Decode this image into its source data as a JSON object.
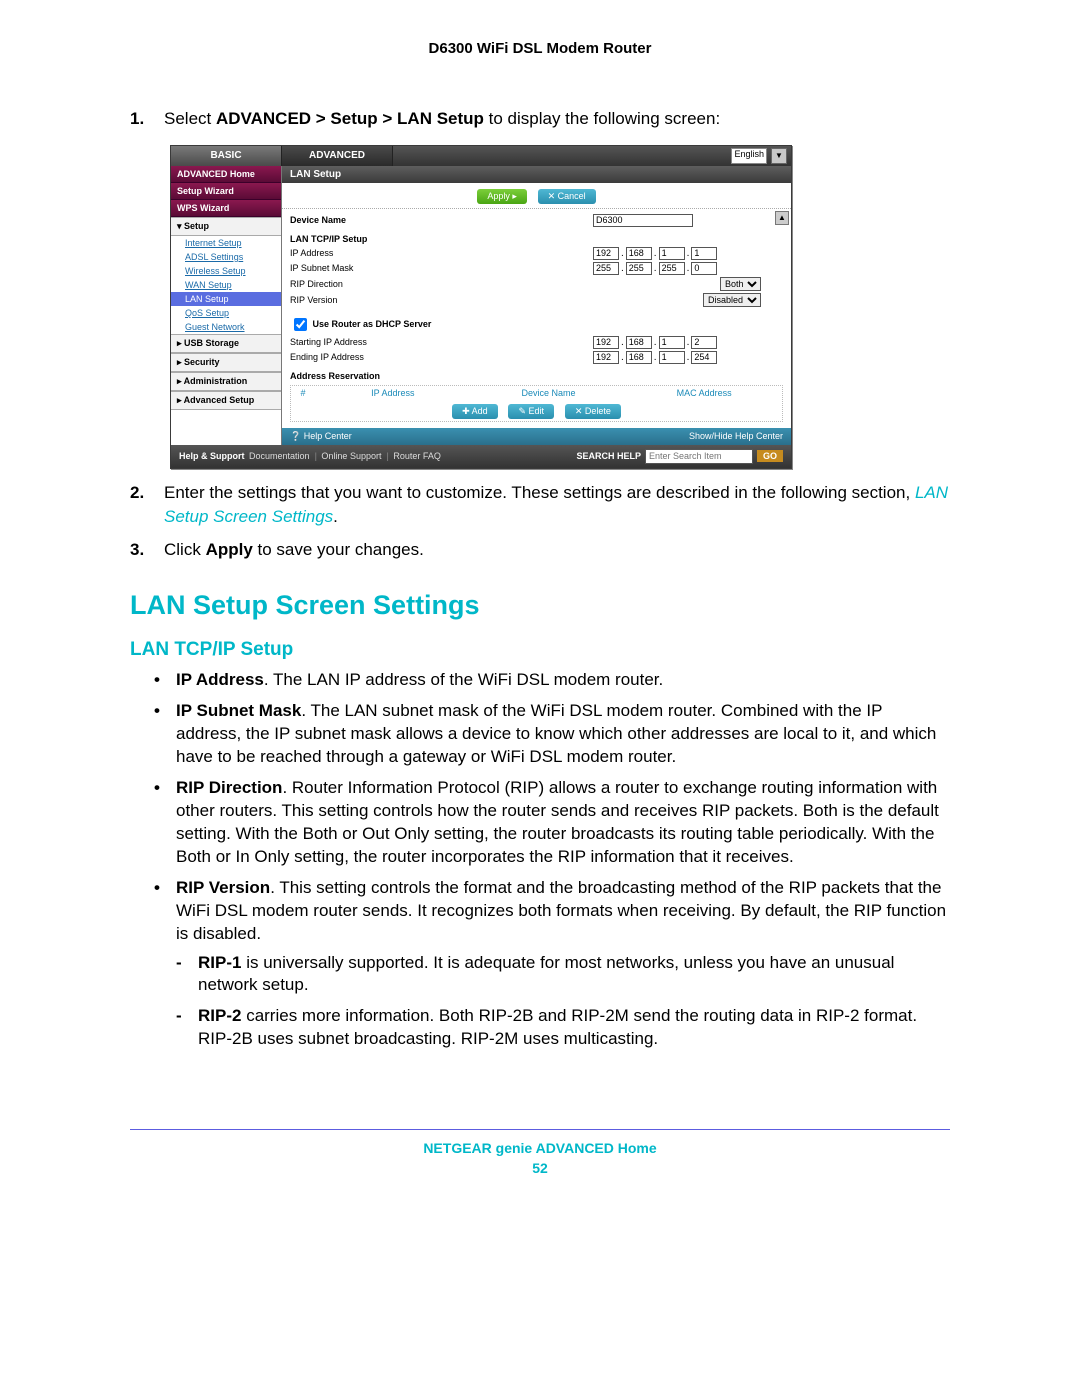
{
  "doc_header": "D6300 WiFi DSL Modem Router",
  "steps": [
    {
      "num": "1.",
      "prefix": "Select ",
      "bold": "ADVANCED > Setup > LAN Setup",
      "suffix": " to display the following screen:"
    },
    {
      "num": "2.",
      "text_a": "Enter the settings that you want to customize. These settings are described in the following section, ",
      "ref": "LAN Setup Screen Settings",
      "text_b": "."
    },
    {
      "num": "3.",
      "prefix": "Click ",
      "bold": "Apply",
      "suffix": " to save your changes."
    }
  ],
  "screenshot": {
    "tabs": {
      "basic": "BASIC",
      "advanced": "ADVANCED",
      "lang": "English"
    },
    "sidebar": {
      "top": [
        "ADVANCED Home",
        "Setup Wizard",
        "WPS Wizard"
      ],
      "setup_header": "▾ Setup",
      "setup_children": [
        "Internet Setup",
        "ADSL Settings",
        "Wireless Setup",
        "WAN Setup",
        "LAN Setup",
        "QoS Setup",
        "Guest Network"
      ],
      "active_child": "LAN Setup",
      "sections": [
        "▸ USB Storage",
        "▸ Security",
        "▸ Administration",
        "▸ Advanced Setup"
      ]
    },
    "panel_title": "LAN Setup",
    "buttons": {
      "apply": "Apply ▸",
      "cancel": "✕ Cancel",
      "add": "✚ Add",
      "edit": "✎ Edit",
      "del": "✕ Delete"
    },
    "device_name": {
      "label": "Device Name",
      "value": "D6300"
    },
    "tcpip_header": "LAN TCP/IP Setup",
    "ip": {
      "label": "IP Address",
      "a": "192",
      "b": "168",
      "c": "1",
      "d": "1"
    },
    "mask": {
      "label": "IP Subnet Mask",
      "a": "255",
      "b": "255",
      "c": "255",
      "d": "0"
    },
    "rip_dir": {
      "label": "RIP Direction",
      "value": "Both"
    },
    "rip_ver": {
      "label": "RIP Version",
      "value": "Disabled"
    },
    "dhcp": {
      "label": "Use Router as DHCP Server",
      "checked": true
    },
    "start": {
      "label": "Starting IP Address",
      "a": "192",
      "b": "168",
      "c": "1",
      "d": "2"
    },
    "end": {
      "label": "Ending IP Address",
      "a": "192",
      "b": "168",
      "c": "1",
      "d": "254"
    },
    "reservation": {
      "header": "Address Reservation",
      "cols": [
        "#",
        "IP Address",
        "Device Name",
        "MAC Address"
      ]
    },
    "help_center": {
      "left": "❔ Help Center",
      "right": "Show/Hide Help Center"
    },
    "footer": {
      "support_label": "Help & Support",
      "doc": "Documentation",
      "online": "Online Support",
      "faq": "Router FAQ",
      "search_label": "SEARCH HELP",
      "search_placeholder": "Enter Search Item",
      "go": "GO"
    }
  },
  "section_heading": "LAN Setup Screen Settings",
  "sub_heading": "LAN TCP/IP Setup",
  "bullets": {
    "ip_address": {
      "head": "IP Address",
      "body": ". The LAN IP address of the WiFi DSL modem router."
    },
    "ip_subnet": {
      "head": "IP Subnet Mask",
      "body": ". The LAN subnet mask of the WiFi DSL modem router. Combined with the IP address, the IP subnet mask allows a device to know which other addresses are local to it, and which have to be reached through a gateway or WiFi DSL modem router."
    },
    "rip_dir": {
      "head": "RIP Direction",
      "body": ". Router Information Protocol (RIP) allows a router to exchange routing information with other routers. This setting controls how the router sends and receives RIP packets. Both is the default setting. With the Both or Out Only setting, the router broadcasts its routing table periodically. With the Both or In Only setting, the router incorporates the RIP information that it receives."
    },
    "rip_ver": {
      "head": "RIP Version",
      "body": ". This setting controls the format and the broadcasting method of the RIP packets that the WiFi DSL modem router sends. It recognizes both formats when receiving. By default, the RIP function is disabled."
    },
    "rip1": {
      "head": "RIP-1",
      "body": " is universally supported. It is adequate for most networks, unless you have an unusual network setup."
    },
    "rip2": {
      "head": "RIP-2",
      "body": " carries more information. Both RIP-2B and RIP-2M send the routing data in RIP-2 format. RIP-2B uses subnet broadcasting. RIP-2M uses multicasting."
    }
  },
  "page_footer": {
    "chapter": "NETGEAR genie ADVANCED Home",
    "page": "52"
  }
}
